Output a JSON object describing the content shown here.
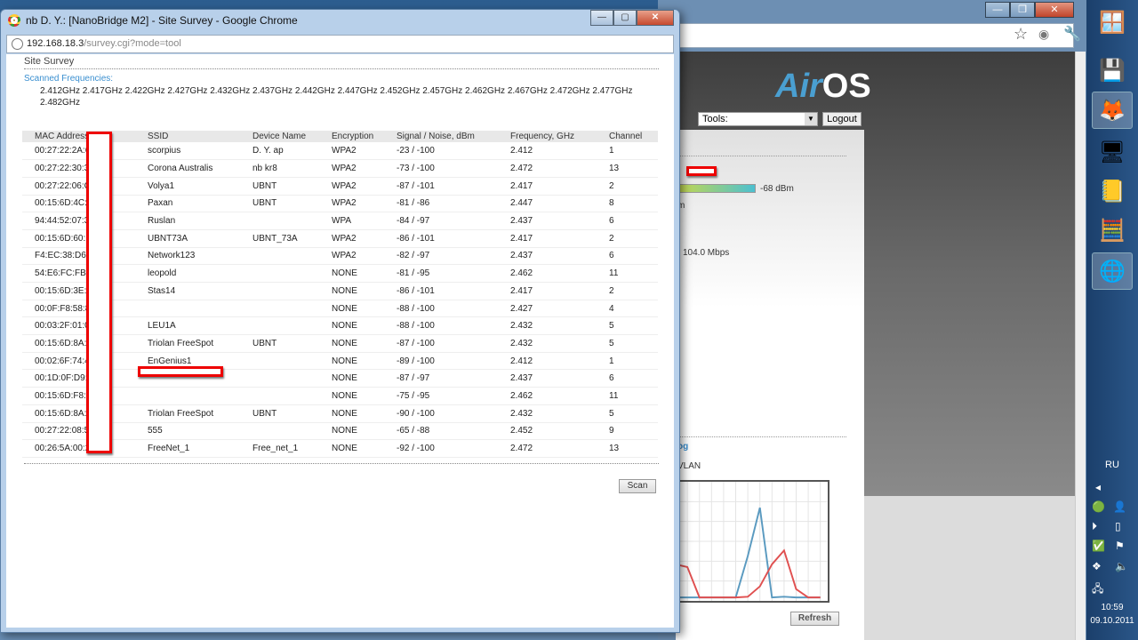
{
  "popup": {
    "title": "nb D. Y.: [NanoBridge M2] - Site Survey - Google Chrome",
    "url_host": "192.168.18.3",
    "url_path": "/survey.cgi?mode=tool",
    "heading": "Site Survey",
    "scanned_label": "Scanned Frequencies:",
    "scanned_frequencies": "2.412GHz 2.417GHz 2.422GHz 2.427GHz 2.432GHz 2.437GHz 2.442GHz 2.447GHz 2.452GHz 2.457GHz 2.462GHz 2.467GHz 2.472GHz 2.477GHz 2.482GHz",
    "columns": [
      "MAC Address",
      "SSID",
      "Device Name",
      "Encryption",
      "Signal / Noise, dBm",
      "Frequency, GHz",
      "Channel"
    ],
    "rows": [
      [
        "00:27:22:2A:6",
        "scorpius",
        "D. Y. ap",
        "WPA2",
        "-23 / -100",
        "2.412",
        "1"
      ],
      [
        "00:27:22:30:3",
        "Corona Australis",
        "nb kr8",
        "WPA2",
        "-73 / -100",
        "2.472",
        "13"
      ],
      [
        "00:27:22:06:C",
        "Volya1",
        "UBNT",
        "WPA2",
        "-87 / -101",
        "2.417",
        "2"
      ],
      [
        "00:15:6D:4C:F",
        "Paxan",
        "UBNT",
        "WPA2",
        "-81 / -86",
        "2.447",
        "8"
      ],
      [
        "94:44:52:07:3",
        "Ruslan",
        "",
        "WPA",
        "-84 / -97",
        "2.437",
        "6"
      ],
      [
        "00:15:6D:60:D",
        "UBNT73A",
        "UBNT_73A",
        "WPA2",
        "-86 / -101",
        "2.417",
        "2"
      ],
      [
        "F4:EC:38:D6:E",
        "Network123",
        "",
        "WPA2",
        "-82 / -97",
        "2.437",
        "6"
      ],
      [
        "54:E6:FC:FB:1",
        "leopold",
        "",
        "NONE",
        "-81 / -95",
        "2.462",
        "11"
      ],
      [
        "00:15:6D:3E:2",
        "Stas14",
        "",
        "NONE",
        "-86 / -101",
        "2.417",
        "2"
      ],
      [
        "00:0F:F8:58:8",
        "",
        "",
        "NONE",
        "-88 / -100",
        "2.427",
        "4"
      ],
      [
        "00:03:2F:01:0",
        "LEU1A",
        "",
        "NONE",
        "-88 / -100",
        "2.432",
        "5"
      ],
      [
        "00:15:6D:8A:1",
        "Triolan FreeSpot",
        "UBNT",
        "NONE",
        "-87 / -100",
        "2.432",
        "5"
      ],
      [
        "00:02:6F:74:4",
        "EnGenius1",
        "",
        "NONE",
        "-89 / -100",
        "2.412",
        "1"
      ],
      [
        "00:1D:0F:D9:0",
        "",
        "",
        "NONE",
        "-87 / -97",
        "2.437",
        "6"
      ],
      [
        "00:15:6D:F8:F",
        "",
        "",
        "NONE",
        "-75 / -95",
        "2.462",
        "11"
      ],
      [
        "00:15:6D:8A:1",
        "Triolan FreeSpot",
        "UBNT",
        "NONE",
        "-90 / -100",
        "2.432",
        "5"
      ],
      [
        "00:27:22:08:5",
        "555",
        "",
        "NONE",
        "-65 / -88",
        "2.452",
        "9"
      ],
      [
        "00:26:5A:00:2",
        "FreeNet_1",
        "Free_net_1",
        "NONE",
        "-92 / -100",
        "2.472",
        "13"
      ]
    ],
    "scan_label": "Scan"
  },
  "background": {
    "logo": {
      "air": "Air",
      "os": "OS"
    },
    "tools_label": "Tools:",
    "logout_label": "Logout",
    "signal_text": "-68 dBm",
    "partial_dbm": "m",
    "rate_text": "104.0 Mbps",
    "log_link": "og",
    "wlan_label": "VLAN",
    "refresh_label": "Refresh",
    "chart": {
      "series": [
        {
          "color": "#5a9ac0",
          "values": [
            0,
            0,
            0,
            0,
            0,
            0,
            30,
            65,
            0,
            0.5,
            0,
            0,
            0
          ]
        },
        {
          "color": "#e05050",
          "values": [
            24,
            22,
            0,
            0,
            0,
            0,
            0.5,
            8,
            24,
            34,
            6,
            0,
            0
          ]
        }
      ]
    }
  },
  "taskbar": {
    "lang": "RU",
    "time": "10:59",
    "date": "09.10.2011"
  }
}
